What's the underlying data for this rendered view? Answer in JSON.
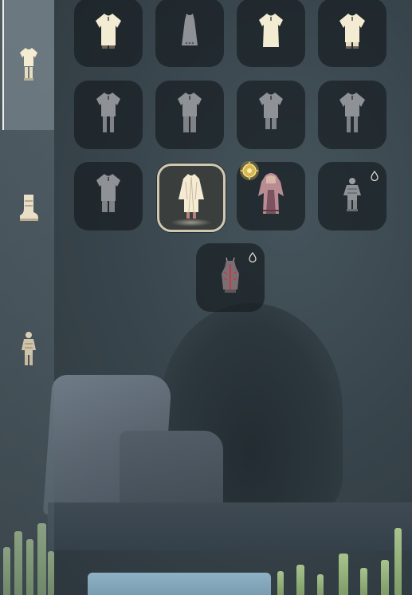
{
  "colors": {
    "locked_outfit": "#8e9196",
    "unlocked_outfit": "#f4ecd2",
    "highlight_frame": "#cfc8b0",
    "gold_badge": "#e2c35a"
  },
  "sidebar": {
    "tabs": [
      {
        "icon": "outfit-icon",
        "state": "active"
      },
      {
        "icon": "shoes-icon",
        "state": "inactive"
      },
      {
        "icon": "full-body-outfit-icon",
        "state": "inactive"
      }
    ]
  },
  "outfits": [
    {
      "icon": "robe-icon",
      "state": "unlocked"
    },
    {
      "icon": "dress-icon",
      "state": "locked"
    },
    {
      "icon": "robe-icon",
      "state": "unlocked"
    },
    {
      "icon": "robe-icon",
      "state": "unlocked"
    },
    {
      "icon": "tunic-pants-icon",
      "state": "locked"
    },
    {
      "icon": "tunic-pants-icon",
      "state": "locked"
    },
    {
      "icon": "tunic-pants-icon",
      "state": "locked"
    },
    {
      "icon": "tunic-pants-icon",
      "state": "locked"
    },
    {
      "icon": "tunic-pants-icon",
      "state": "locked"
    },
    {
      "icon": "white-coat-icon",
      "state": "equipped"
    },
    {
      "icon": "hooded-robe-icon",
      "state": "unlocked",
      "badge": "gold-gear-icon"
    },
    {
      "icon": "armored-outfit-icon",
      "state": "candle-purchasable",
      "badge": "candle-drop-icon"
    },
    {
      "icon": "red-ribbon-outfit-icon",
      "state": "candle-purchasable",
      "badge": "candle-drop-icon"
    }
  ]
}
